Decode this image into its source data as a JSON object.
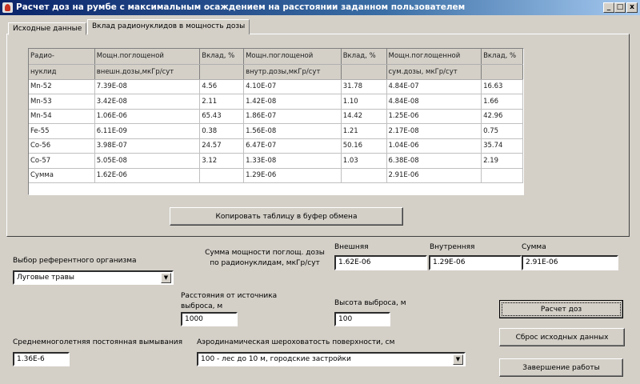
{
  "window": {
    "title": "Расчет доз на румбе с максимальным осаждением на расстоянии заданном пользователем",
    "minimize": "_",
    "maximize": "□",
    "close": "x"
  },
  "tabs": [
    {
      "label": "Исходные данные"
    },
    {
      "label": "Вклад радионуклидов в мощность дозы"
    }
  ],
  "table": {
    "headers": [
      [
        "Радио-",
        "Мощн.поглощеной",
        "Вклад, %",
        "Мощн.поглощеной",
        "Вклад, %",
        "Мощн.поглощенной",
        "Вклад, %"
      ],
      [
        "нуклид",
        "внешн.дозы,мкГр/сут",
        "",
        "внутр.дозы,мкГр/сут",
        "",
        "сум.дозы, мкГр/сут",
        ""
      ]
    ],
    "rows": [
      [
        "Mn-52",
        "7.39E-08",
        "4.56",
        "4.10E-07",
        "31.78",
        "4.84E-07",
        "16.63"
      ],
      [
        "Mn-53",
        "3.42E-08",
        "2.11",
        "1.42E-08",
        "1.10",
        "4.84E-08",
        "1.66"
      ],
      [
        "Mn-54",
        "1.06E-06",
        "65.43",
        "1.86E-07",
        "14.42",
        "1.25E-06",
        "42.96"
      ],
      [
        "Fe-55",
        "6.11E-09",
        "0.38",
        "1.56E-08",
        "1.21",
        "2.17E-08",
        "0.75"
      ],
      [
        "Co-56",
        "3.98E-07",
        "24.57",
        "6.47E-07",
        "50.16",
        "1.04E-06",
        "35.74"
      ],
      [
        "Co-57",
        "5.05E-08",
        "3.12",
        "1.33E-08",
        "1.03",
        "6.38E-08",
        "2.19"
      ],
      [
        "Сумма",
        "1.62E-06",
        "",
        "1.29E-06",
        "",
        "2.91E-06",
        ""
      ]
    ]
  },
  "copy_button": "Копировать таблицу в буфер обмена",
  "organism": {
    "label": "Выбор референтного организма",
    "value": "Луговые травы"
  },
  "sum": {
    "label1": "Сумма мощности поглощ. дозы",
    "label2": "по радионуклидам, мкГр/сут",
    "external_label": "Внешняя",
    "external": "1.62E-06",
    "internal_label": "Внутренняя",
    "internal": "1.29E-06",
    "total_label": "Сумма",
    "total": "2.91E-06"
  },
  "distance": {
    "label1": "Расстояния от источника",
    "label2": "выброса, м",
    "value": "1000"
  },
  "height": {
    "label": "Высота выброса, м",
    "value": "100"
  },
  "washout": {
    "label": "Среднемноголетняя постоянная вымывания",
    "value": "1.36E-6"
  },
  "roughness": {
    "label": "Аэродинамическая шероховатость поверхности, см",
    "value": "100 - лес до 10 м, городские застройки"
  },
  "buttons": {
    "calc": "Расчет доз",
    "reset": "Сброс исходных данных",
    "exit": "Завершение работы"
  }
}
